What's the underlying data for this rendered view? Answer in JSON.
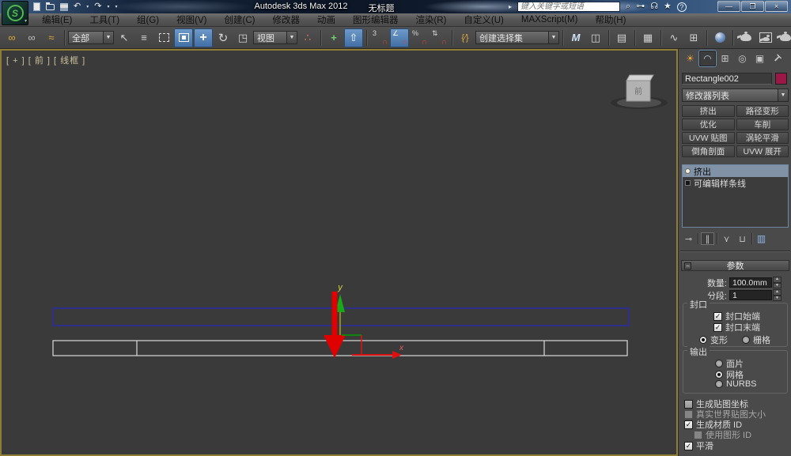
{
  "titlebar": {
    "product": "Autodesk 3ds Max 2012",
    "document": "无标题",
    "search_placeholder": "键入关键字或短语"
  },
  "menubar": {
    "items": [
      "编辑(E)",
      "工具(T)",
      "组(G)",
      "视图(V)",
      "创建(C)",
      "修改器",
      "动画",
      "图形编辑器",
      "渲染(R)",
      "自定义(U)",
      "MAXScript(M)",
      "帮助(H)"
    ]
  },
  "toolbar": {
    "selection_filter_value": "全部",
    "reference_coord_value": "视图",
    "named_selection_value": "创建选择集"
  },
  "viewport": {
    "label": "[ + ]  [ 前 ]  [ 线框 ]",
    "viewcube_face": "前",
    "gizmo": {
      "x_label": "x",
      "y_label": "y"
    }
  },
  "command_panel": {
    "object_name": "Rectangle002",
    "wirecolor": "#9c1745",
    "modifier_list_label": "修改器列表",
    "modifier_buttons": [
      "挤出",
      "路径变形",
      "优化",
      "车削",
      "UVW 贴图",
      "涡轮平滑",
      "倒角剖面",
      "UVW 展开"
    ],
    "stack": {
      "item1": "挤出",
      "item2": "可编辑样条线"
    },
    "params": {
      "header": "参数",
      "amount_label": "数量:",
      "amount_value": "100.0mm",
      "segments_label": "分段:",
      "segments_value": "1",
      "cap_group": "封口",
      "cap_start": "封口始端",
      "cap_end": "封口末端",
      "morph": "变形",
      "grid": "栅格",
      "output_group": "输出",
      "patch": "面片",
      "mesh": "网格",
      "nurbs": "NURBS",
      "gen_mapping": "生成贴图坐标",
      "real_world": "真实世界贴图大小",
      "gen_matid": "生成材质 ID",
      "use_shapeid": "使用图形 ID",
      "smooth": "平滑"
    }
  },
  "icons": {
    "logo": "S",
    "undo": "↶",
    "redo": "↷",
    "dropdown": "▼",
    "small_dropdown": "▾",
    "flyout_arrow": "▸",
    "link": "∞",
    "unlink": "∞",
    "bind_spacewarp": "≈",
    "select_object": "↖",
    "select_by_name": "≡",
    "move": "+",
    "rotate": "↻",
    "scale": "◳",
    "use_center": "∴",
    "manipulate": "+",
    "keyboard_override": "⇧",
    "snap3d": "3",
    "magnet": "∩",
    "angle_snap": "∠",
    "percent_snap": "%",
    "spinner_snap": "⇅",
    "named_sets_braces": "{⁄}",
    "mirror": "M",
    "align": "◫",
    "layers": "▤",
    "graphite": "▦",
    "curve_editor": "∿",
    "schematic": "⊞",
    "search": "⌕",
    "key": "⊶",
    "communication": "☊",
    "favorites": "★",
    "help": "?",
    "minimize": "—",
    "maximize": "❐",
    "close": "×",
    "tab_create": "☀",
    "tab_modify": "◠",
    "tab_hierarchy": "⊞",
    "tab_motion": "◎",
    "tab_display": "▣",
    "tab_utilities": "T",
    "pin_stack": "⊸",
    "show_end_result": "∥",
    "make_unique": "⋎",
    "remove_modifier": "⊔",
    "configure_sets": "▥",
    "minus": "−",
    "spin_up": "▲",
    "spin_down": "▼",
    "check": "✓"
  }
}
